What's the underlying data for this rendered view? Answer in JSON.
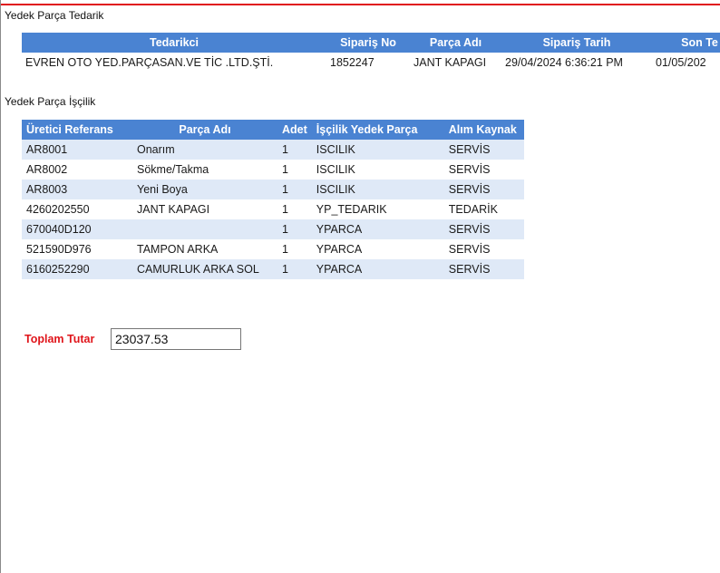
{
  "colors": {
    "accent_rule": "#e0151b",
    "header_bg": "#4a83d2",
    "row_alt_bg": "#dfe9f7",
    "total_label": "#e0151b"
  },
  "supply": {
    "title": "Yedek Parça Tedarik",
    "columns": [
      "Tedarikci",
      "Sipariş No",
      "Parça Adı",
      "Sipariş Tarih",
      "Son Te"
    ],
    "rows": [
      [
        "EVREN OTO YED.PARÇASAN.VE TİC .LTD.ŞTİ.",
        "1852247",
        "JANT KAPAGI",
        "29/04/2024 6:36:21 PM",
        "01/05/202"
      ]
    ]
  },
  "labor": {
    "title": "Yedek Parça İşçilik",
    "columns": [
      "Üretici Referans",
      "Parça Adı",
      "Adet",
      "İşçilik Yedek Parça",
      "Alım Kaynak"
    ],
    "rows": [
      [
        "AR8001",
        "Onarım",
        "1",
        "ISCILIK",
        "SERVİS"
      ],
      [
        "AR8002",
        "Sökme/Takma",
        "1",
        "ISCILIK",
        "SERVİS"
      ],
      [
        "AR8003",
        "Yeni Boya",
        "1",
        "ISCILIK",
        "SERVİS"
      ],
      [
        "4260202550",
        "JANT KAPAGI",
        "1",
        "YP_TEDARIK",
        "TEDARİK"
      ],
      [
        "670040D120",
        "",
        "1",
        "YPARCA",
        "SERVİS"
      ],
      [
        "521590D976",
        "TAMPON ARKA",
        "1",
        "YPARCA",
        "SERVİS"
      ],
      [
        "6160252290",
        "CAMURLUK ARKA SOL",
        "1",
        "YPARCA",
        "SERVİS"
      ]
    ]
  },
  "total": {
    "label": "Toplam Tutar",
    "value": "23037.53"
  }
}
